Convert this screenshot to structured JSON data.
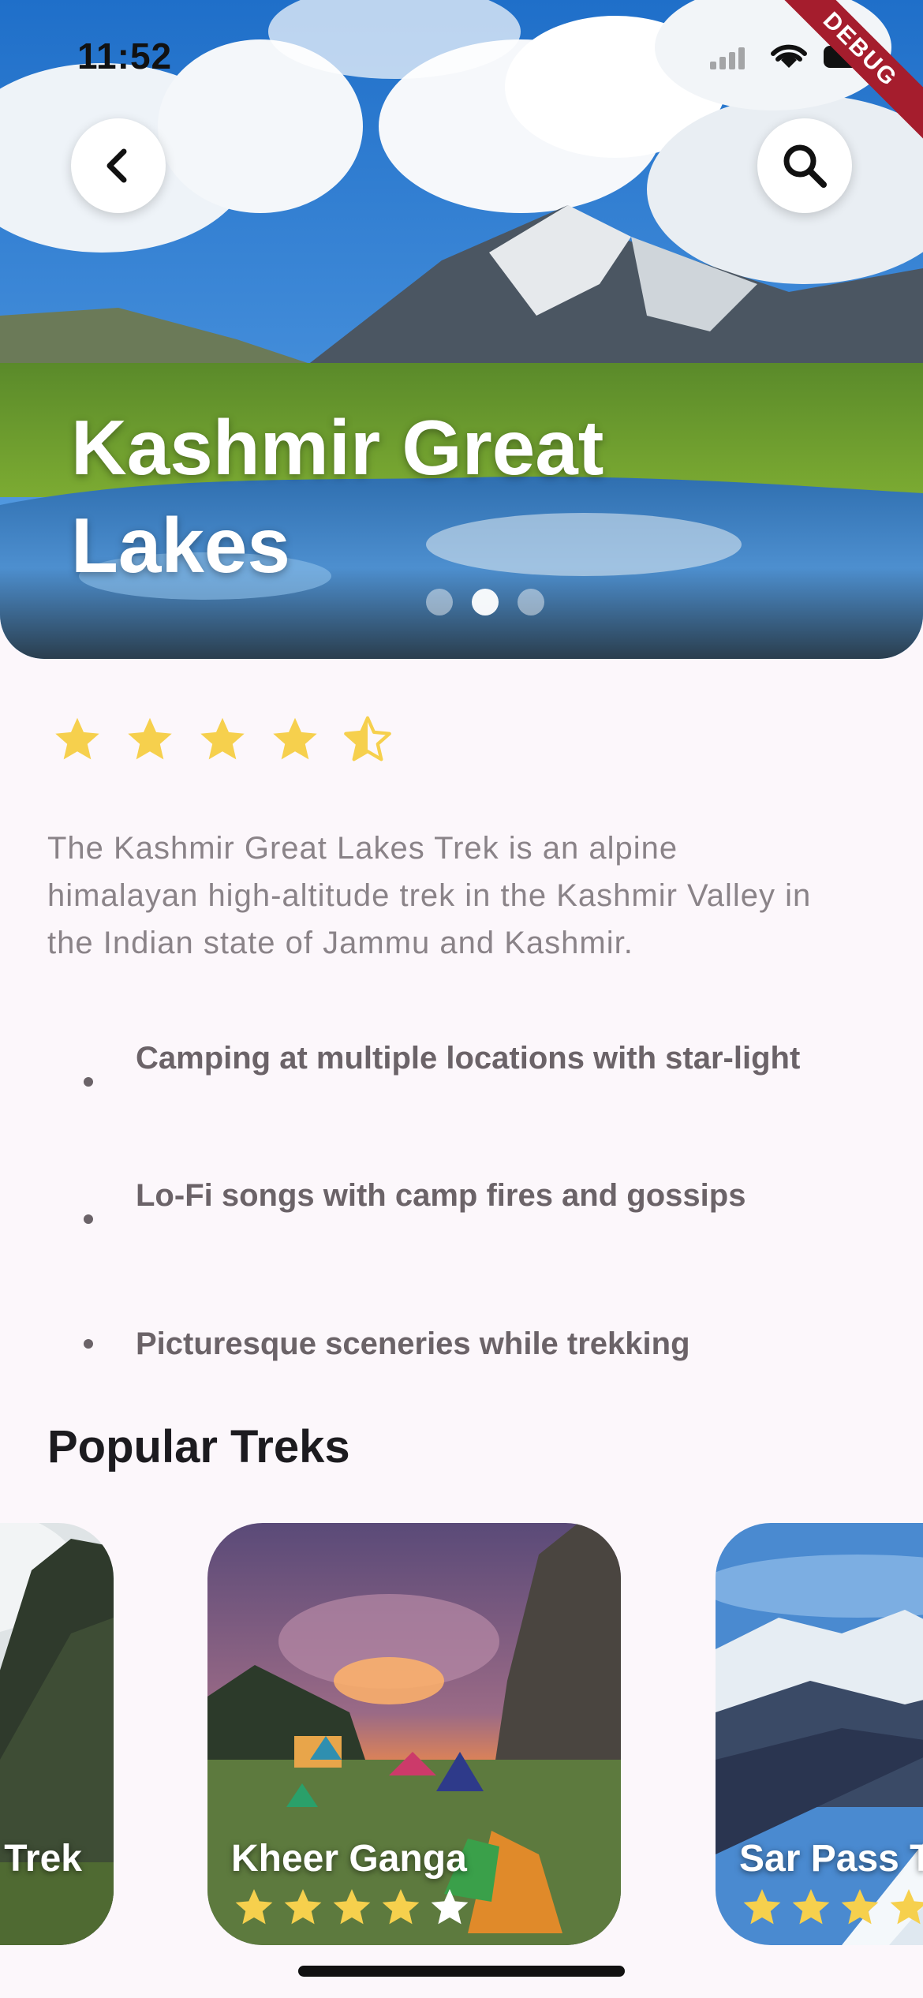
{
  "status_bar": {
    "time": "11:52"
  },
  "debug_banner": "DEBUG",
  "hero": {
    "title_line1": "Kashmir Great",
    "title_line2": "Lakes",
    "carousel_dots": 3,
    "active_dot": 1
  },
  "trek": {
    "rating": 4.5,
    "description": "The Kashmir Great Lakes Trek is an alpine himalayan high-altitude trek in the Kashmir Valley in the Indian state of Jammu and Kashmir.",
    "features": [
      "Camping at multiple locations with star-light",
      "Lo-Fi songs with camp fires and gossips",
      "Picturesque sceneries while trekking"
    ]
  },
  "popular": {
    "title": "Popular Treks",
    "cards": [
      {
        "name": "Trek",
        "rating": null
      },
      {
        "name": "Kheer Ganga",
        "rating": 4
      },
      {
        "name": "Sar Pass T",
        "rating": null
      }
    ]
  },
  "colors": {
    "background": "#fcf7fb",
    "star": "#f6d04d",
    "body_text": "#8a8388",
    "feature_text": "#6b6368",
    "heading": "#1c1b1f"
  },
  "icons": {
    "back": "chevron-left-icon",
    "search": "search-icon",
    "star": "star-icon",
    "half_star": "star-half-icon"
  }
}
